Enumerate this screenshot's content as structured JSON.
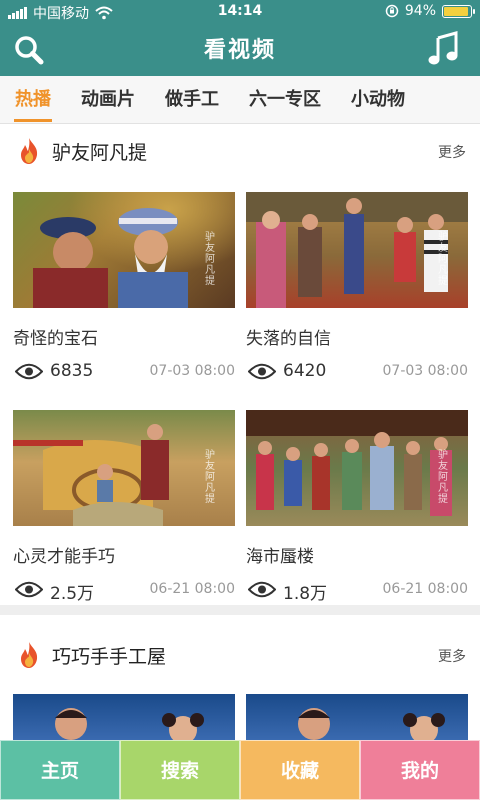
{
  "status_bar": {
    "carrier": "中国移动",
    "time": "14:14",
    "battery_text": "94%",
    "battery_level": 0.94
  },
  "header": {
    "title": "看视频",
    "search_icon": "search-icon",
    "music_icon": "music-note-icon"
  },
  "tabs": [
    {
      "label": "热播",
      "active": true
    },
    {
      "label": "动画片",
      "active": false
    },
    {
      "label": "做手工",
      "active": false
    },
    {
      "label": "六一专区",
      "active": false
    },
    {
      "label": "小动物",
      "active": false
    }
  ],
  "sections": [
    {
      "title": "驴友阿凡提",
      "more": "更多",
      "videos": [
        {
          "title": "奇怪的宝石",
          "views": "6835",
          "date": "07-03 08:00"
        },
        {
          "title": "失落的自信",
          "views": "6420",
          "date": "07-03 08:00"
        },
        {
          "title": "心灵才能手巧",
          "views": "2.5万",
          "date": "06-21 08:00"
        },
        {
          "title": "海市蜃楼",
          "views": "1.8万",
          "date": "06-21 08:00"
        }
      ]
    },
    {
      "title": "巧巧手手工屋",
      "more": "更多"
    }
  ],
  "bottom_nav": [
    {
      "label": "主页",
      "color": "#5cc0a4"
    },
    {
      "label": "搜索",
      "color": "#a8d66a"
    },
    {
      "label": "收藏",
      "color": "#f5b95f"
    },
    {
      "label": "我的",
      "color": "#ef7f99"
    }
  ],
  "colors": {
    "header_bg": "#3a8f8a",
    "accent": "#f0932b"
  }
}
